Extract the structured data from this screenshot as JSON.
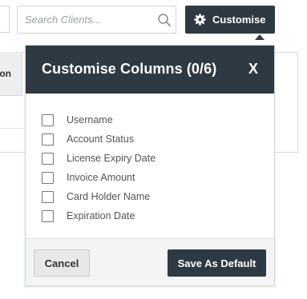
{
  "background": {
    "button_label_fragment": "on"
  },
  "search": {
    "placeholder": "Search Clients...",
    "value": "",
    "icon": "search-icon"
  },
  "customise_button": {
    "label": "Customise",
    "icon": "gear-icon"
  },
  "popover": {
    "title": "Customise Columns (0/6)",
    "close_label": "X",
    "options": [
      {
        "label": "Username",
        "checked": false
      },
      {
        "label": "Account Status",
        "checked": false
      },
      {
        "label": "License Expiry Date",
        "checked": false
      },
      {
        "label": "Invoice Amount",
        "checked": false
      },
      {
        "label": "Card Holder Name",
        "checked": false
      },
      {
        "label": "Expiration Date",
        "checked": false
      }
    ],
    "cancel_label": "Cancel",
    "save_label": "Save As Default"
  },
  "colors": {
    "dark_accent": "#2e3a43",
    "footer_bg": "#f3f4f5"
  }
}
